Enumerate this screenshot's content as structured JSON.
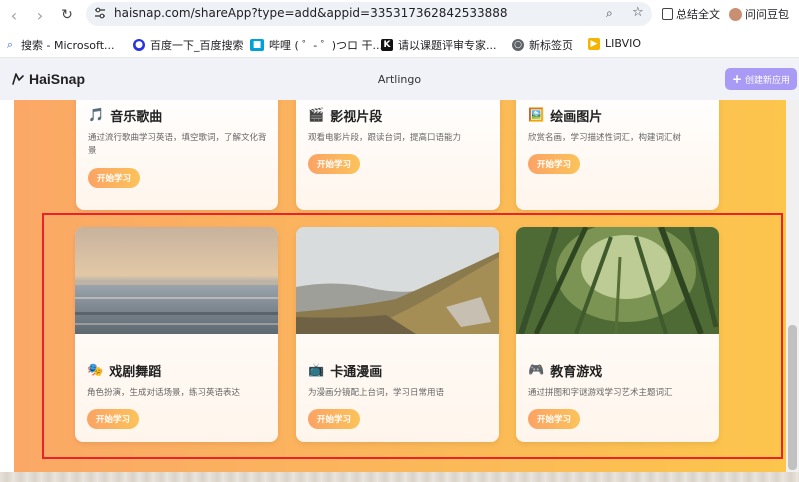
{
  "browser": {
    "url": "haisnap.com/shareApp?type=add&appid=335317362842533888",
    "summary_label": "总结全文",
    "profile_label": "问问豆包"
  },
  "bookmarks": [
    {
      "label": "搜索 - Microsoft...",
      "icon": "search-icon",
      "color": "#3b6de0"
    },
    {
      "label": "百度一下_百度搜索",
      "icon": "baidu-paw-icon",
      "color": "#2932e1"
    },
    {
      "label": "哔哩 ( ゜- ゜)つロ 干...",
      "icon": "bilibili-icon",
      "color": "#00a1d6"
    },
    {
      "label": "请以课题评审专家...",
      "icon": "k-icon",
      "color": "#111111"
    },
    {
      "label": "新标签页",
      "icon": "globe-icon",
      "color": "#5f6368"
    },
    {
      "label": "LIBVIO",
      "icon": "libvio-icon",
      "color": "#f5b400"
    }
  ],
  "app": {
    "logo_text": "HaiSnap",
    "title": "Artlingo",
    "create_label": "创建新应用"
  },
  "cards": [
    {
      "icon": "music-note-icon",
      "emoji": "🎵",
      "title": "音乐歌曲",
      "desc": "通过流行歌曲学习英语，填空歌词，了解文化背景",
      "button": "开始学习"
    },
    {
      "icon": "clapperboard-icon",
      "emoji": "🎬",
      "title": "影视片段",
      "desc": "观看电影片段，跟读台词，提高口语能力",
      "button": "开始学习"
    },
    {
      "icon": "painting-icon",
      "emoji": "🖼️",
      "title": "绘画图片",
      "desc": "欣赏名画，学习描述性词汇，构建词汇树",
      "button": "开始学习"
    },
    {
      "icon": "theater-mask-icon",
      "emoji": "🎭",
      "title": "戏剧舞蹈",
      "desc": "角色扮演，生成对话场景，练习英语表达",
      "button": "开始学习"
    },
    {
      "icon": "tv-icon",
      "emoji": "📺",
      "title": "卡通漫画",
      "desc": "为漫画分镜配上台词，学习日常用语",
      "button": "开始学习"
    },
    {
      "icon": "gamepad-icon",
      "emoji": "🎮",
      "title": "教育游戏",
      "desc": "通过拼图和字谜游戏学习艺术主题词汇",
      "button": "开始学习"
    }
  ],
  "colors": {
    "accent": "#a99bf5",
    "highlight": "#e8232b",
    "button_start": "#fba365",
    "button_end": "#fbc35a"
  }
}
